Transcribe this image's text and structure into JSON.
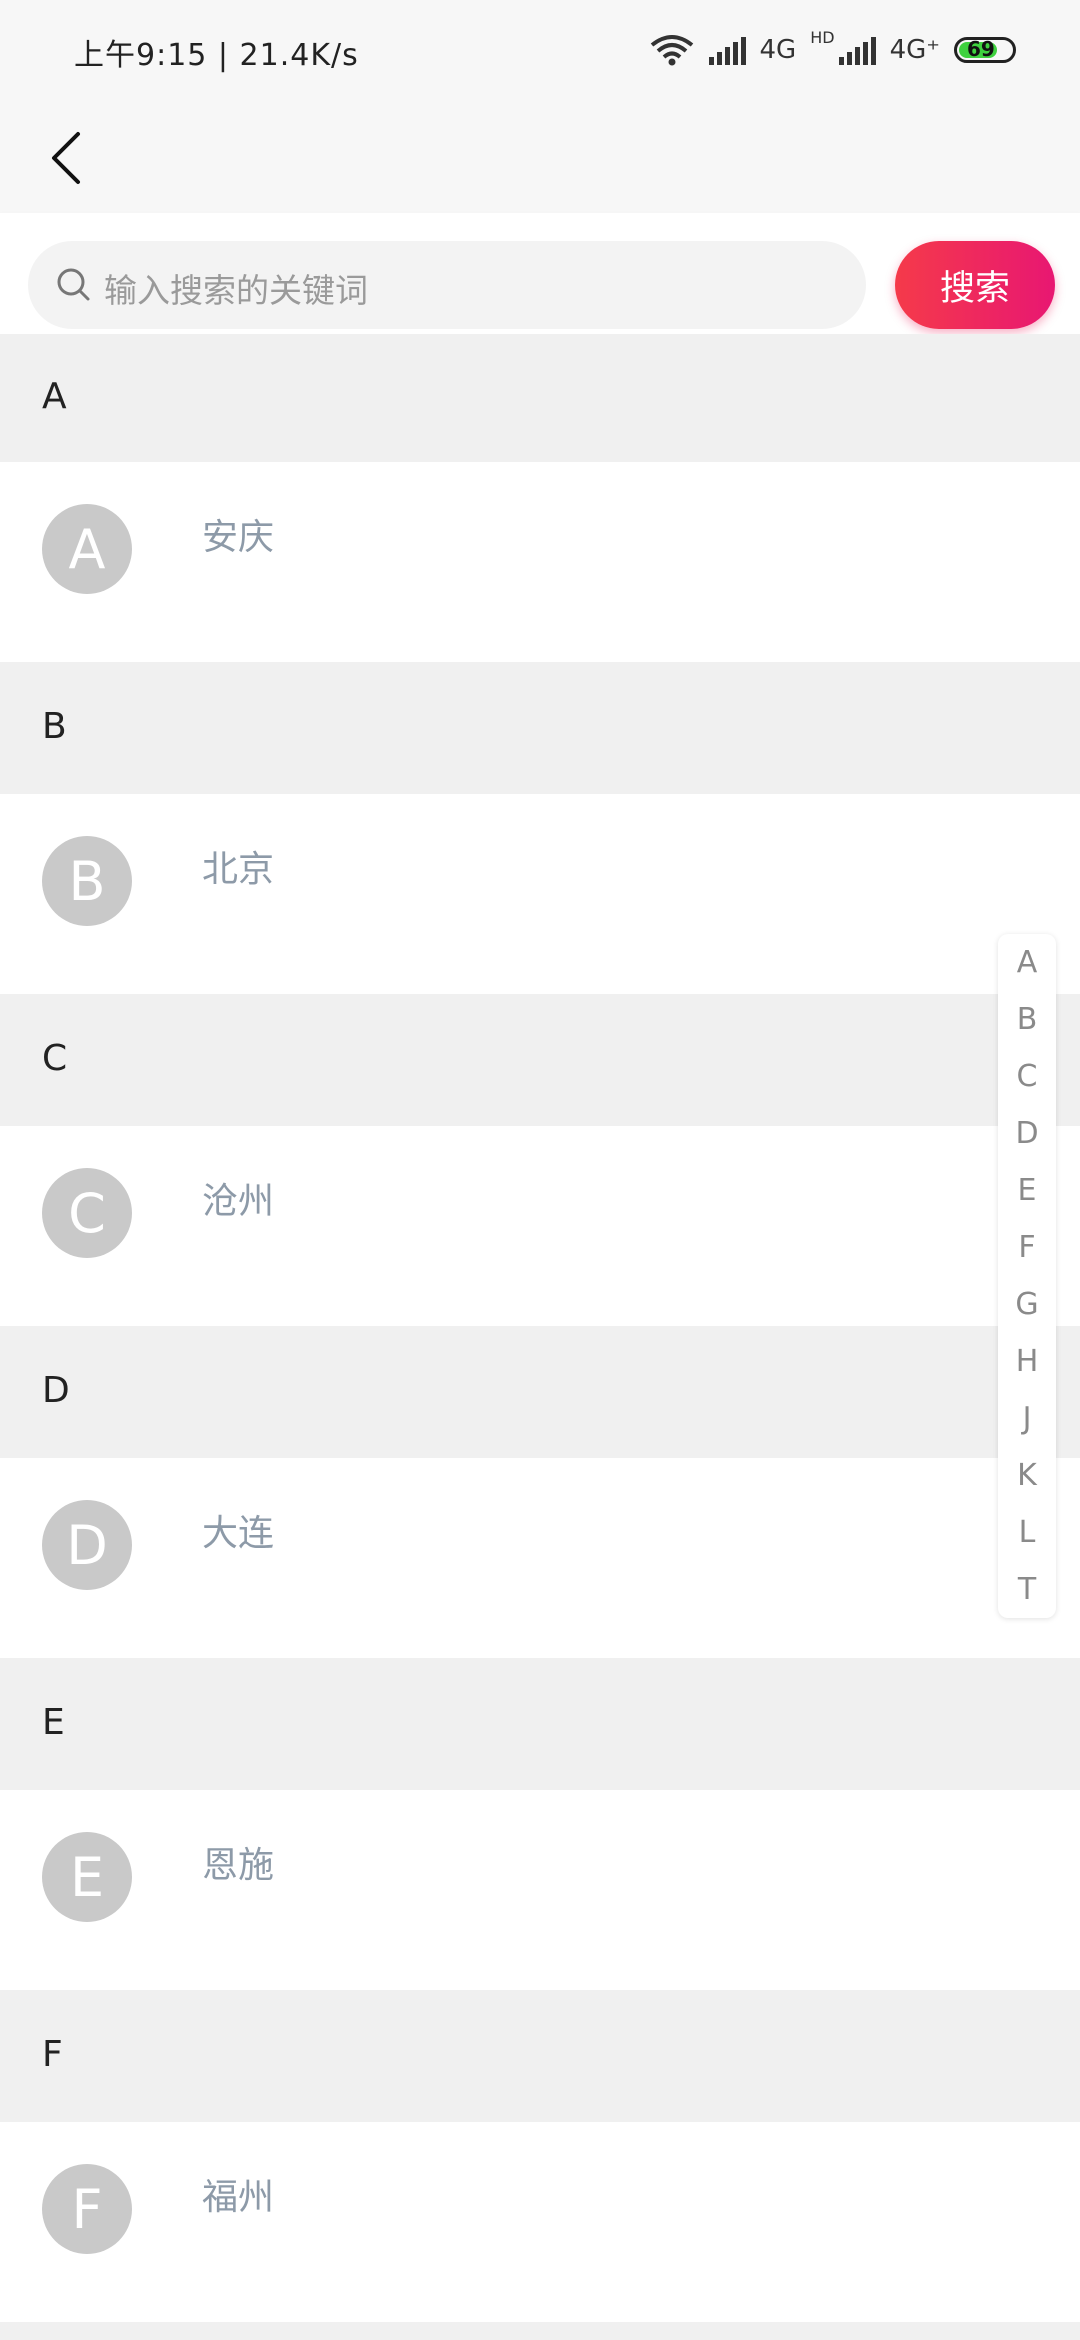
{
  "status_bar": {
    "time_text": "上午9:15 | 21.4K/s",
    "network_1": "4G",
    "hd_label": "HD",
    "network_2": "4G⁺",
    "battery": "69"
  },
  "search": {
    "placeholder": "输入搜索的关键词",
    "button_label": "搜索"
  },
  "sections": [
    {
      "letter": "A",
      "city": "安庆",
      "avatar": "A"
    },
    {
      "letter": "B",
      "city": "北京",
      "avatar": "B"
    },
    {
      "letter": "C",
      "city": "沧州",
      "avatar": "C"
    },
    {
      "letter": "D",
      "city": "大连",
      "avatar": "D"
    },
    {
      "letter": "E",
      "city": "恩施",
      "avatar": "E"
    },
    {
      "letter": "F",
      "city": "福州",
      "avatar": "F"
    }
  ],
  "index_letters": [
    "A",
    "B",
    "C",
    "D",
    "E",
    "F",
    "G",
    "H",
    "J",
    "K",
    "L",
    "T"
  ],
  "colors": {
    "accent_start": "#f53a4a",
    "accent_end": "#e81772",
    "section_bg": "#f0f0f0",
    "avatar_bg": "#c9c9c9",
    "city_text": "#8d9aa8"
  },
  "icons": {
    "back": "chevron-left-icon",
    "search": "search-icon",
    "wifi": "wifi-icon",
    "signal": "signal-icon",
    "battery": "battery-icon"
  }
}
